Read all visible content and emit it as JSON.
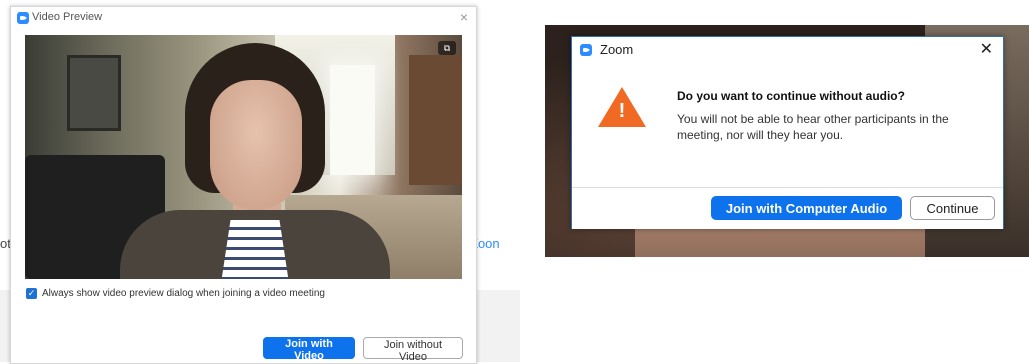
{
  "preview_window": {
    "title": "Video Preview",
    "close_glyph": "×",
    "camera_toggle_glyph": "⧉",
    "checkbox_checked": true,
    "checkbox_glyph": "✓",
    "checkbox_label": "Always show video preview dialog when joining a video meeting",
    "join_with_video": "Join with Video",
    "join_without_video": "Join without Video"
  },
  "background_fragments": {
    "left_edge_text": "ot",
    "right_edge_text": "Zoon"
  },
  "audio_dialog": {
    "title": "Zoom",
    "close_glyph": "✕",
    "warning_glyph": "!",
    "heading": "Do you want to continue without audio?",
    "body": "You will not be able to hear other participants in the meeting, nor will they hear you.",
    "join_computer_audio": "Join with Computer Audio",
    "continue": "Continue"
  },
  "colors": {
    "accent_blue": "#0e72ed",
    "warning_orange": "#f06a24",
    "zoom_brand": "#2d8cff"
  },
  "icons": {
    "app": "zoom-camera-icon",
    "warning": "warning-triangle-icon",
    "close": "close-icon",
    "camera_toggle": "camera-switch-icon",
    "checkbox": "checkmark-icon"
  }
}
